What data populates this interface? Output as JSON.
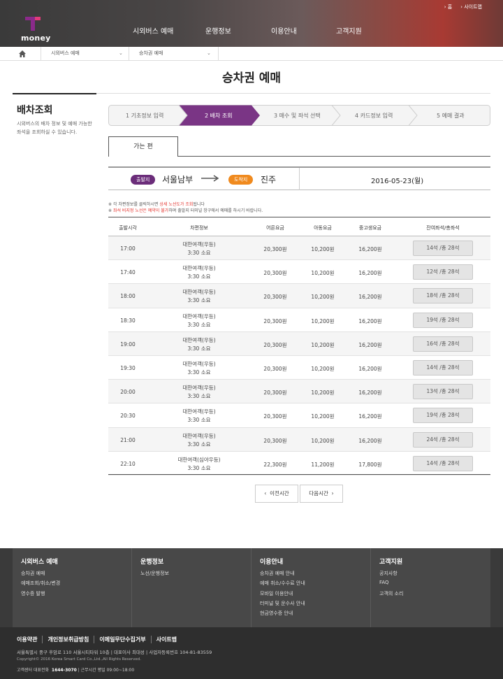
{
  "utility": {
    "home": "홈",
    "sitemap": "사이트맵"
  },
  "logo": {
    "word": "money"
  },
  "gnb": [
    "시외버스 예매",
    "운행정보",
    "이용안내",
    "고객지원"
  ],
  "breadcrumb": {
    "seg1": "시외버스 예매",
    "seg2": "승차권 예매"
  },
  "page_title": "승차권 예매",
  "lnb": {
    "title": "배차조회",
    "desc": "시외버스의 배차 정보 및 예매 가능한 좌석을 조회하실 수 있습니다."
  },
  "steps": [
    "1 기초정보 입력",
    "2 배차 조회",
    "3 매수 및 좌석 선택",
    "4 카드정보 입력",
    "5 예매 결과"
  ],
  "tab": "가는 편",
  "route": {
    "dep_badge": "출발지",
    "dep": "서울남부",
    "arr_badge": "도착지",
    "arr": "진주",
    "date": "2016-05-23(월)"
  },
  "notes": {
    "n1_a": "※ 각 차편정보를 클릭하시면 ",
    "n1_red": "상세 노선도가 조회",
    "n1_b": "됩니다",
    "n2_a": "※ ",
    "n2_red": "좌석 비지정 노선은 예약이 불가",
    "n2_b": "하며 출발지 터미널 창구에서 예매를 하시기 바랍니다."
  },
  "table": {
    "headers": [
      "출발시각",
      "차편정보",
      "어른요금",
      "아동요금",
      "중고생요금",
      "잔여좌석/총좌석"
    ],
    "rows": [
      {
        "time": "17:00",
        "company": "대한여객(우등)",
        "duration": "3:30 소요",
        "adult": "20,300원",
        "child": "10,200원",
        "teen": "16,200원",
        "seats": "14석 /총 28석"
      },
      {
        "time": "17:40",
        "company": "대한여객(우등)",
        "duration": "3:30 소요",
        "adult": "20,300원",
        "child": "10,200원",
        "teen": "16,200원",
        "seats": "12석 /총 28석"
      },
      {
        "time": "18:00",
        "company": "대한여객(우등)",
        "duration": "3:30 소요",
        "adult": "20,300원",
        "child": "10,200원",
        "teen": "16,200원",
        "seats": "18석 /총 28석"
      },
      {
        "time": "18:30",
        "company": "대한여객(우등)",
        "duration": "3:30 소요",
        "adult": "20,300원",
        "child": "10,200원",
        "teen": "16,200원",
        "seats": "19석 /총 28석"
      },
      {
        "time": "19:00",
        "company": "대한여객(우등)",
        "duration": "3:30 소요",
        "adult": "20,300원",
        "child": "10,200원",
        "teen": "16,200원",
        "seats": "16석 /총 28석"
      },
      {
        "time": "19:30",
        "company": "대한여객(우등)",
        "duration": "3:30 소요",
        "adult": "20,300원",
        "child": "10,200원",
        "teen": "16,200원",
        "seats": "14석 /총 28석"
      },
      {
        "time": "20:00",
        "company": "대한여객(우등)",
        "duration": "3:30 소요",
        "adult": "20,300원",
        "child": "10,200원",
        "teen": "16,200원",
        "seats": "13석 /총 28석"
      },
      {
        "time": "20:30",
        "company": "대한여객(우등)",
        "duration": "3:30 소요",
        "adult": "20,300원",
        "child": "10,200원",
        "teen": "16,200원",
        "seats": "19석 /총 28석"
      },
      {
        "time": "21:00",
        "company": "대한여객(우등)",
        "duration": "3:30 소요",
        "adult": "20,300원",
        "child": "10,200원",
        "teen": "16,200원",
        "seats": "24석 /총 28석"
      },
      {
        "time": "22:10",
        "company": "대한여객(심야우등)",
        "duration": "3:30 소요",
        "adult": "22,300원",
        "child": "11,200원",
        "teen": "17,800원",
        "seats": "14석 /총 28석"
      }
    ]
  },
  "pager": {
    "prev": "이전시간",
    "next": "다음시간"
  },
  "footer": {
    "cols": [
      {
        "title": "시외버스 예매",
        "items": [
          "승차권 예매",
          "예매조회/취소/변경",
          "영수증 발행"
        ]
      },
      {
        "title": "운행정보",
        "items": [
          "노선/운행정보"
        ]
      },
      {
        "title": "이용안내",
        "items": [
          "승차권 예매 안내",
          "예매 취소/수수료 안내",
          "모바일 이용안내",
          "터미널 및 운수사 안내",
          "현금영수증 안내"
        ]
      },
      {
        "title": "고객지원",
        "items": [
          "공지사항",
          "FAQ",
          "고객의 소리"
        ]
      }
    ],
    "links": [
      "이용약관",
      "개인정보취급방침",
      "이메일무단수집거부",
      "사이트맵"
    ],
    "address": "서울특별시 중구 후암로 110 서울시티타워 10층  |  대표이사 최대성  |  사업자등록번호 104-81-83559",
    "copyright": "Copyright© 2016 Korea Smart Card Co.,Ltd.,All Rights Reserved.",
    "tel_label": "고객센터 대표전화",
    "tel": "1644-3070",
    "hours": " | 근무시간 평일 09:00~18:00"
  },
  "colors": {
    "brand_purple": "#6b2d7a",
    "accent_orange": "#f08a1e",
    "notice_red": "#e4312b"
  }
}
